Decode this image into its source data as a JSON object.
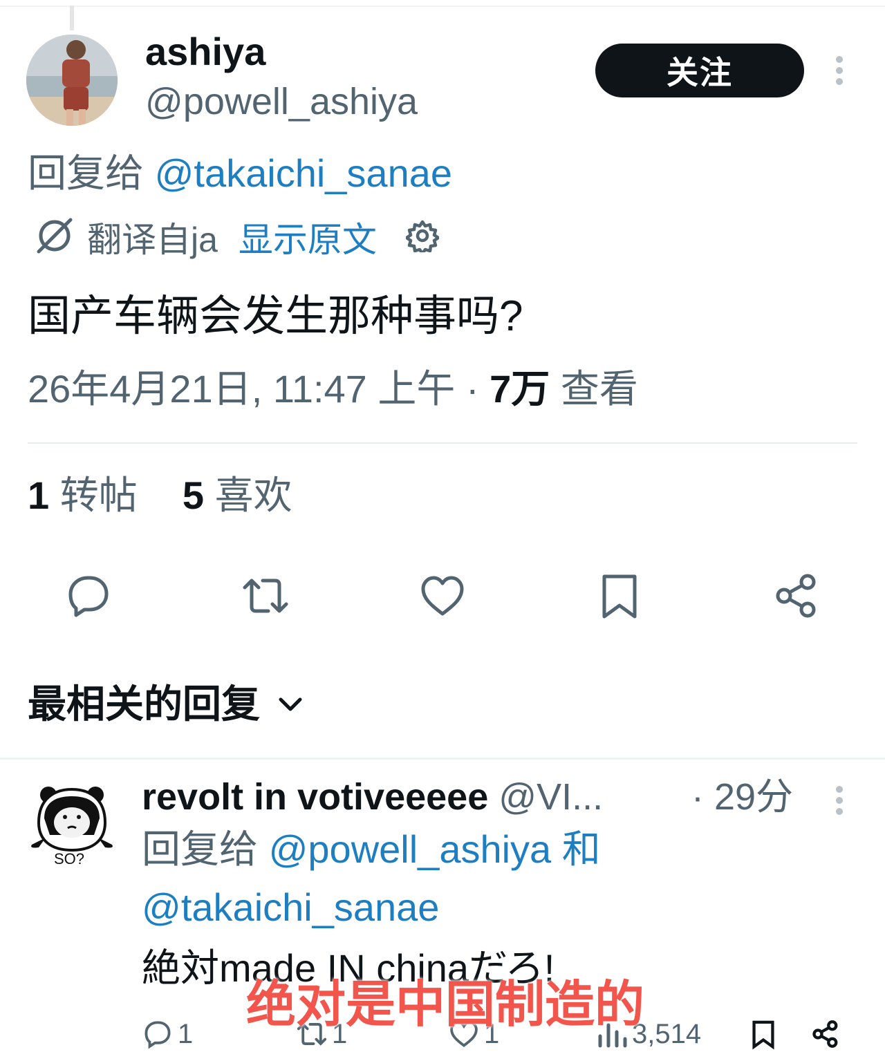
{
  "post": {
    "author_name": "ashiya",
    "author_handle": "@powell_ashiya",
    "follow_label": "关注",
    "reply_to_prefix": "回复给",
    "reply_to_handle": "@takaichi_sanae",
    "translated_from": "翻译自ja",
    "show_original": "显示原文",
    "text": "国产车辆会发生那种事吗?",
    "timestamp": "26年4月21日, 11:47 上午 ·",
    "views_count": "7万",
    "views_label": "查看",
    "reposts_count": "1",
    "reposts_label": "转帖",
    "likes_count": "5",
    "likes_label": "喜欢"
  },
  "replies_header": "最相关的回复",
  "reply": {
    "author_name": "revolt in votiveeeee",
    "author_handle": "@VI...",
    "time": "· 29分",
    "avatar_caption": "SO?",
    "reply_to_prefix": "回复给",
    "reply_to_handle1": "@powell_ashiya",
    "reply_to_and": "和",
    "reply_to_handle2": "@takaichi_sanae",
    "text": "絶対made IN chinaだろ!",
    "replies_count": "1",
    "reposts_count": "1",
    "likes_count": "1",
    "views_count": "3,514"
  },
  "subtitle": "绝对是中国制造的",
  "icons": {
    "translate": "translate-icon",
    "settings": "gear-icon",
    "reply": "reply-icon",
    "repost": "repost-icon",
    "like": "heart-icon",
    "bookmark": "bookmark-icon",
    "share": "share-icon",
    "more": "more-vertical-icon",
    "chevron": "chevron-down-icon",
    "views": "views-icon"
  },
  "colors": {
    "text": "#0f1419",
    "secondary": "#536471",
    "link": "#1d7fc2",
    "button": "#0f1419",
    "subtitle": "#f2554c"
  }
}
